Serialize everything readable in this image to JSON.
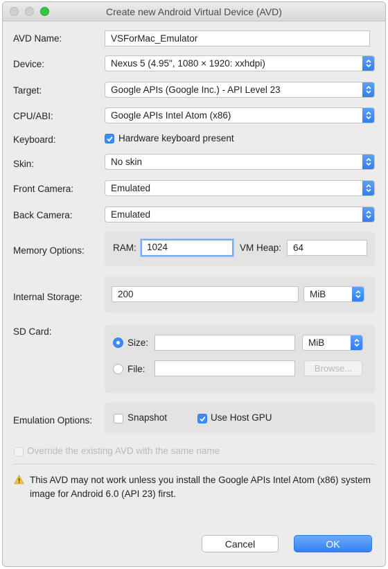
{
  "window": {
    "title": "Create new Android Virtual Device (AVD)"
  },
  "form": {
    "avd_name_label": "AVD Name:",
    "avd_name_value": "VSForMac_Emulator",
    "device_label": "Device:",
    "device_value": "Nexus 5 (4.95\", 1080 × 1920: xxhdpi)",
    "target_label": "Target:",
    "target_value": "Google APIs (Google Inc.) - API Level 23",
    "cpu_label": "CPU/ABI:",
    "cpu_value": "Google APIs Intel Atom (x86)",
    "keyboard_label": "Keyboard:",
    "keyboard_checkbox_label": "Hardware keyboard present",
    "keyboard_checked": true,
    "skin_label": "Skin:",
    "skin_value": "No skin",
    "front_camera_label": "Front Camera:",
    "front_camera_value": "Emulated",
    "back_camera_label": "Back Camera:",
    "back_camera_value": "Emulated",
    "memory": {
      "label": "Memory Options:",
      "ram_label": "RAM:",
      "ram_value": "1024",
      "vm_heap_label": "VM Heap:",
      "vm_heap_value": "64"
    },
    "internal_storage": {
      "label": "Internal Storage:",
      "value": "200",
      "unit": "MiB"
    },
    "sd_card": {
      "label": "SD Card:",
      "size_label": "Size:",
      "size_value": "",
      "size_unit": "MiB",
      "file_label": "File:",
      "file_value": "",
      "browse_label": "Browse...",
      "selected": "size"
    },
    "emulation": {
      "label": "Emulation Options:",
      "snapshot_label": "Snapshot",
      "snapshot_checked": false,
      "host_gpu_label": "Use Host GPU",
      "host_gpu_checked": true
    },
    "override_label": "Override the existing AVD with the same name",
    "override_checked": false
  },
  "warning": {
    "icon": "warning-triangle-icon",
    "text": "This AVD may not work unless you install the Google APIs Intel Atom (x86) system image for Android 6.0 (API 23) first."
  },
  "buttons": {
    "cancel_label": "Cancel",
    "ok_label": "OK"
  },
  "colors": {
    "accent": "#3d8bf5",
    "window_bg": "#ececec",
    "maximize": "#35c648"
  }
}
